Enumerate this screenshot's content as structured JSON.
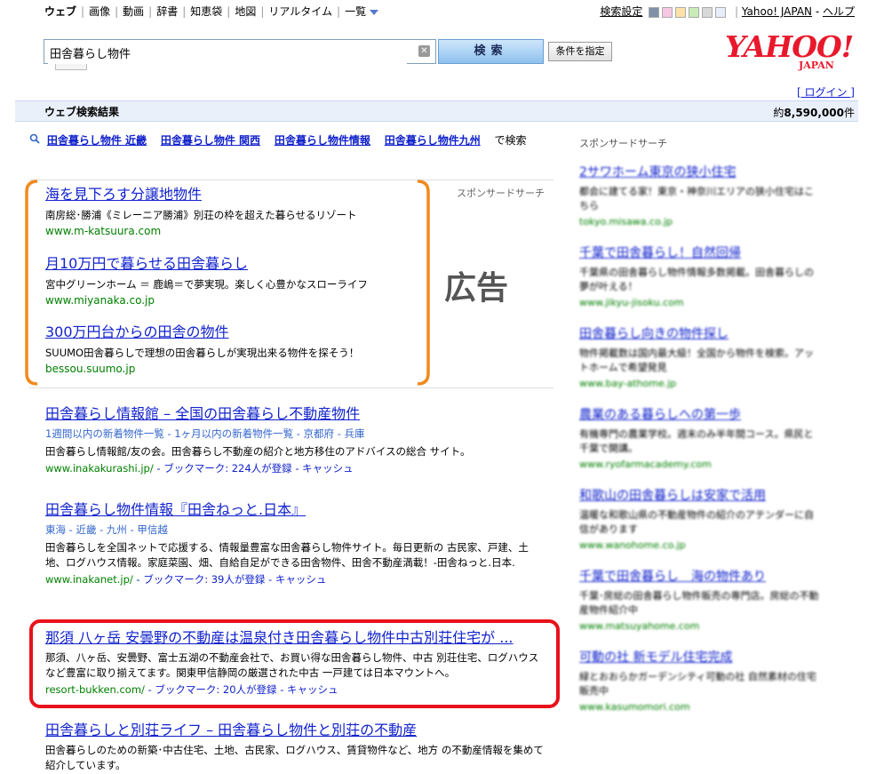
{
  "topnav": {
    "items": [
      "ウェブ",
      "画像",
      "動画",
      "辞書",
      "知恵袋",
      "地図",
      "リアルタイム"
    ],
    "more": "一覧"
  },
  "topright": {
    "settings": "検索設定",
    "swatches": [
      "#8090a8",
      "#f6c8e2",
      "#fde2a8",
      "#c9ecb7",
      "#d8d8d8",
      "#e6eefa"
    ],
    "yahoo": "Yahoo! JAPAN",
    "help": "ヘルプ"
  },
  "search": {
    "query": "田舎暮らし物件",
    "button": "検索",
    "conditions": "条件を指定"
  },
  "logo": {
    "main": "YAHOO!",
    "sub": "JAPAN"
  },
  "login": "[ ログイン ]",
  "results_header": {
    "title": "ウェブ検索結果",
    "count_prefix": "約",
    "count": "8,590,000",
    "count_suffix": "件"
  },
  "related": {
    "links": [
      "田舎暮らし物件 近畿",
      "田舎暮らし物件 関西",
      "田舎暮らし物件情報",
      "田舎暮らし物件九州"
    ],
    "suffix": "で検索"
  },
  "ads": {
    "label": "スポンサードサーチ",
    "big_label": "広告",
    "items": [
      {
        "title": "海を見下ろす分譲地物件",
        "desc": "南房総･勝浦《ミレーニア勝浦》別荘の枠を超えた暮らせるリゾート",
        "url": "www.m-katsuura.com"
      },
      {
        "title": "月10万円で暮らせる田舎暮らし",
        "desc": "宮中グリーンホーム ＝ 鹿嶋＝で夢実現。楽しく心豊かなスローライフ",
        "url": "www.miyanaka.co.jp"
      },
      {
        "title": "300万円台からの田舎の物件",
        "desc": "SUUMO田舎暮らしで理想の田舎暮らしが実現出来る物件を探そう！",
        "url": "bessou.suumo.jp"
      }
    ]
  },
  "results": [
    {
      "title": "田舎暮らし情報館 – 全国の田舎暮らし不動産物件",
      "crumb": "1週間以内の新着物件一覧 - 1ヶ月以内の新着物件一覧 - 京都府 - 兵庫",
      "desc": "田舎暮らし情報館/友の会。田舎暮らし不動産の紹介と地方移住のアドバイスの総合 サイト。",
      "url": "www.inakakurashi.jp/",
      "bookmark": " - ブックマーク: 224人が登録 - キャッシュ"
    },
    {
      "title": "田舎暮らし物件情報『田舎ねっと.日本』",
      "crumb": "東海 - 近畿 - 九州 - 甲信越",
      "desc": "田舎暮らしを全国ネットで応援する、情報量豊富な田舎暮らし物件サイト。毎日更新の 古民家、戸建、土地、ログハウス情報。家庭菜園、畑、自給自足ができる田舎物件、田舎不動産満載！-田舎ねっと.日本.",
      "url": "www.inakanet.jp/",
      "bookmark": " - ブックマーク: 39人が登録 - キャッシュ"
    },
    {
      "title": "那須 八ヶ岳 安曇野の不動産は温泉付き田舎暮らし物件中古別荘住宅が ...",
      "desc": "那須、八ヶ岳、安曇野、富士五湖の不動産会社で、お買い得な田舎暮らし物件、中古 別荘住宅、ログハウスなど豊富に取り揃えてます。関東甲信静岡の厳選された中古 一戸建ては日本マウントへ。",
      "url": "resort-bukken.com/",
      "bookmark": " - ブックマーク: 20人が登録 - キャッシュ"
    },
    {
      "title": "田舎暮らしと別荘ライフ – 田舎暮らし物件と別荘の不動産",
      "desc": "田舎暮らしのための新築･中古住宅、土地、古民家、ログハウス、賃貸物件など、地方 の不動産情報を集めて紹介しています。"
    }
  ],
  "sidebar": {
    "heading": "スポンサードサーチ",
    "ads": [
      {
        "title": "2サワホーム東京の狭小住宅",
        "desc": "都会に建てる家！東京・神奈川エリアの狭小住宅はこちら",
        "url": "tokyo.misawa.co.jp"
      },
      {
        "title": "千葉で田舎暮らし！自然回帰",
        "desc": "千葉県の田舎暮らし物件情報多数掲載。田舎暮らしの夢が叶える！",
        "url": "www.jikyu-jisoku.com"
      },
      {
        "title": "田舎暮らし向きの物件探し",
        "desc": "物件掲載数は国内最大級！全国から物件を検索。アットホームで希望発見",
        "url": "www.bay-athome.jp"
      },
      {
        "title": "農業のある暮らしへの第一歩",
        "desc": "有機専門の農業学校。週末のみ半年間コース。県民と千葉で開講。",
        "url": "www.ryofarmacademy.com"
      },
      {
        "title": "和歌山の田舎暮らしは安家で活用",
        "desc": "温暖な和歌山県の不動産物件の紹介のアテンダーに自信があります",
        "url": "www.wanohome.co.jp"
      },
      {
        "title": "千葉で田舎暮らし　海の物件あり",
        "desc": "千葉･房総の田舎暮らし物件販売の専門店。房総の不動産物件紹介中",
        "url": "www.matsuyahome.com"
      },
      {
        "title": "可動の社 新モデル住宅完成",
        "desc": "緑とおおらかガーデンシティ可動の社 自然素材の住宅販売中",
        "url": "www.kasumomori.com"
      }
    ]
  }
}
